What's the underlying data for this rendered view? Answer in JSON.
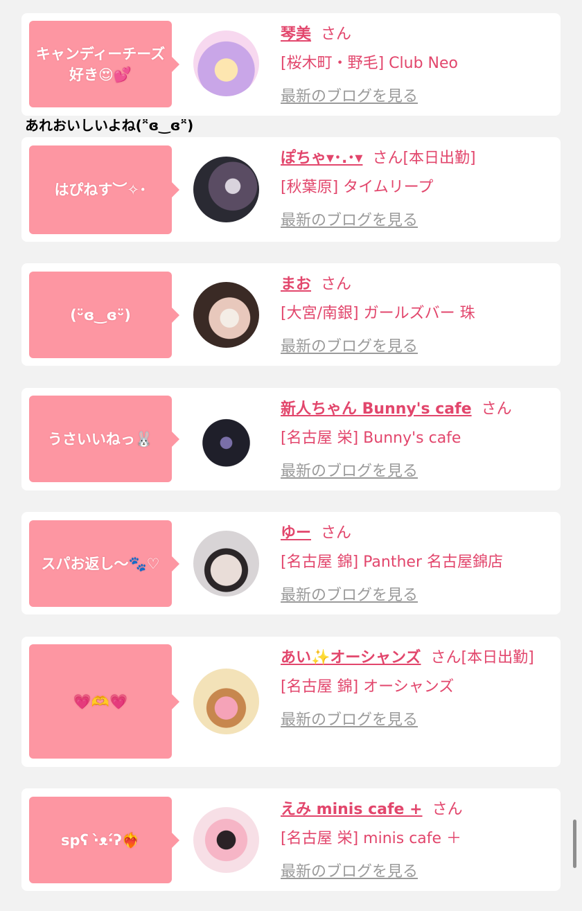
{
  "entries": [
    {
      "bubble": "キャンディーチーズ好き😍💕",
      "name": "琴美",
      "san": "さん",
      "status": "",
      "shop": "[桜木町・野毛] Club Neo",
      "blog": "最新のブログを見る",
      "avatar_colors": [
        "#f7d8ef",
        "#c9a6e8",
        "#fde6b0"
      ]
    },
    {
      "bubble": "はぴねす︶✧･",
      "name": "ぽちゃ▾･.･▾",
      "san": "さん",
      "status": "[本日出勤]",
      "shop": "[秋葉原] タイムリープ",
      "blog": "最新のブログを見る",
      "avatar_colors": [
        "#2a2a33",
        "#5a4c63",
        "#d9d3dd"
      ]
    },
    {
      "bubble": "(ᵕ̈ɞ‿ɞᵕ̈)",
      "name": "まお",
      "san": "さん",
      "status": "",
      "shop": "[大宮/南銀] ガールズバー 珠",
      "blog": "最新のブログを見る",
      "avatar_colors": [
        "#3a2a25",
        "#e8c8bc",
        "#f4ede6"
      ]
    },
    {
      "bubble": "うさいいねっ🐰",
      "name": "新人ちゃん Bunny's cafe",
      "san": "さん",
      "status": "",
      "shop": "[名古屋 栄] Bunny's cafe",
      "blog": "最新のブログを見る",
      "avatar_colors": [
        "#ffffff",
        "#1f1f2a",
        "#7a6fa8"
      ]
    },
    {
      "bubble": "スパお返し〜🐾♡",
      "name": "ゆー",
      "san": "さん",
      "status": "",
      "shop": "[名古屋 錦] Panther 名古屋錦店",
      "blog": "最新のブログを見る",
      "avatar_colors": [
        "#d8d4d6",
        "#2b2628",
        "#e9ddd8"
      ]
    },
    {
      "bubble": "💗🫶💗",
      "name": "あい✨オーシャンズ",
      "san": "さん",
      "status": "[本日出勤]",
      "shop": "[名古屋 錦] オーシャンズ",
      "blog": "最新のブログを見る",
      "avatar_colors": [
        "#f3e2b8",
        "#f5a3b8",
        "#c7874e"
      ]
    },
    {
      "bubble": "spʕ ·̀ᴥ·́ʔ❤️‍🔥",
      "name": "えみ minis cafe +",
      "san": "さん",
      "status": "",
      "shop": "[名古屋 栄] minis cafe ＋",
      "blog": "最新のブログを見る",
      "avatar_colors": [
        "#f7dfe6",
        "#f6b5c6",
        "#2a2226"
      ]
    }
  ],
  "overlay_comment": "あれおいしいよね(ᵔ̈ɞ‿ɞᵔ̈)",
  "colors": {
    "accent": "#e2466c",
    "bubble": "#fd96a2",
    "muted": "#9a9a9a",
    "background": "#f2f2f2"
  }
}
